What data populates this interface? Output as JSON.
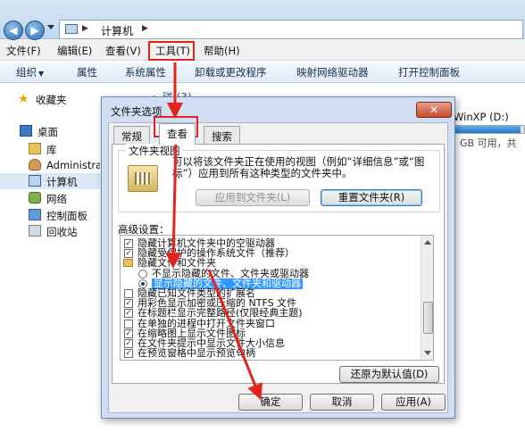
{
  "explorer": {
    "address": {
      "arrow_1": "▶",
      "location": "计算机",
      "arrow_2": "▶"
    },
    "nav": {
      "back": "◀",
      "forward": "▶"
    },
    "menu": [
      {
        "label": "文件(F)"
      },
      {
        "label": "编辑(E)"
      },
      {
        "label": "查看(V)"
      },
      {
        "label": "工具(T)"
      },
      {
        "label": "帮助(H)"
      }
    ],
    "toolbar": [
      {
        "label": "组织",
        "caret": "▼"
      },
      {
        "label": "属性"
      },
      {
        "label": "系统属性"
      },
      {
        "label": "卸载或更改程序"
      },
      {
        "label": "映射网络驱动器"
      },
      {
        "label": "打开控制面板"
      }
    ],
    "sidebar": [
      {
        "label": "收藏夹",
        "icon": "star-icon"
      },
      {
        "label": "桌面",
        "icon": "desktop-icon"
      },
      {
        "label": "库",
        "icon": "library-icon"
      },
      {
        "label": "Administra",
        "icon": "user-icon"
      },
      {
        "label": "计算机",
        "icon": "computer-icon"
      },
      {
        "label": "网络",
        "icon": "network-icon"
      },
      {
        "label": "控制面板",
        "icon": "control-panel-icon"
      },
      {
        "label": "回收站",
        "icon": "recycle-bin-icon"
      }
    ],
    "content": {
      "header": "▸ 碰 (3)",
      "drive_label": "WinXP (D:)",
      "drive_free": "GB 可用，共",
      "drive_used_fraction": 0.95
    }
  },
  "dialog": {
    "title": "文件夹选项",
    "close_label": "✕",
    "tabs": [
      {
        "label": "常规",
        "selected": false
      },
      {
        "label": "查看",
        "selected": true
      },
      {
        "label": "搜索",
        "selected": false
      }
    ],
    "folder_views": {
      "title": "文件夹视图",
      "description": "可以将该文件夹正在使用的视图（例如“详细信息”或“图标”）应用到所有这种类型的文件夹中。",
      "apply_button": "应用到文件夹(L)",
      "reset_button": "重置文件夹(R)"
    },
    "advanced": {
      "label": "高级设置：",
      "items": [
        {
          "text": "隐藏计算机文件夹中的空驱动器",
          "type": "checkbox",
          "checked": true,
          "indent": 0
        },
        {
          "text": "隐藏受保护的操作系统文件（推荐）",
          "type": "checkbox",
          "checked": true,
          "indent": 0
        },
        {
          "text": "隐藏文件和文件夹",
          "type": "folder",
          "checked": false,
          "indent": 0
        },
        {
          "text": "不显示隐藏的文件、文件夹或驱动器",
          "type": "radio",
          "checked": false,
          "indent": 1
        },
        {
          "text": "显示隐藏的文件、文件夹和驱动器",
          "type": "radio",
          "checked": true,
          "indent": 1,
          "selected": true
        },
        {
          "text": "隐藏已知文件类型的扩展名",
          "type": "checkbox",
          "checked": false,
          "indent": 0
        },
        {
          "text": "用彩色显示加密或压缩的 NTFS 文件",
          "type": "checkbox",
          "checked": true,
          "indent": 0
        },
        {
          "text": "在标题栏显示完整路径(仅限经典主题)",
          "type": "checkbox",
          "checked": true,
          "indent": 0
        },
        {
          "text": "在单独的进程中打开文件夹窗口",
          "type": "checkbox",
          "checked": false,
          "indent": 0
        },
        {
          "text": "在缩略图上显示文件图标",
          "type": "checkbox",
          "checked": true,
          "indent": 0
        },
        {
          "text": "在文件夹提示中显示文件大小信息",
          "type": "checkbox",
          "checked": true,
          "indent": 0
        },
        {
          "text": "在预览窗格中显示预览句柄",
          "type": "checkbox",
          "checked": true,
          "indent": 0
        }
      ],
      "restore_button": "还原为默认值(D)"
    },
    "buttons": {
      "ok": "确定",
      "cancel": "取消",
      "apply": "应用(A)"
    }
  },
  "colors": {
    "annotation": "#e4231f",
    "selection": "#3399ff",
    "accent": "#2b6db3"
  }
}
